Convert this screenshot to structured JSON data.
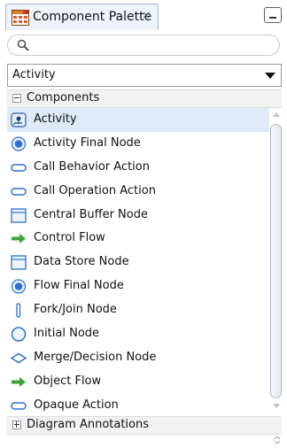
{
  "tab": {
    "title": "Component Palette",
    "close": "×"
  },
  "search": {
    "placeholder": "",
    "value": ""
  },
  "dropdown": {
    "selected": "Activity"
  },
  "sections": {
    "components": "Components",
    "diagram_annotations": "Diagram Annotations"
  },
  "items": [
    {
      "label": "Activity",
      "icon": "activity-icon"
    },
    {
      "label": "Activity Final Node",
      "icon": "activity-final-node-icon"
    },
    {
      "label": "Call Behavior Action",
      "icon": "action-icon"
    },
    {
      "label": "Call Operation Action",
      "icon": "action-icon"
    },
    {
      "label": "Central Buffer Node",
      "icon": "buffer-node-icon"
    },
    {
      "label": "Control Flow",
      "icon": "flow-arrow-icon"
    },
    {
      "label": "Data Store Node",
      "icon": "buffer-node-icon"
    },
    {
      "label": "Flow Final Node",
      "icon": "final-node-icon"
    },
    {
      "label": "Fork/Join Node",
      "icon": "fork-join-icon"
    },
    {
      "label": "Initial Node",
      "icon": "initial-node-icon"
    },
    {
      "label": "Merge/Decision Node",
      "icon": "decision-icon"
    },
    {
      "label": "Object Flow",
      "icon": "flow-arrow-icon"
    },
    {
      "label": "Opaque Action",
      "icon": "action-icon"
    }
  ],
  "colors": {
    "selection": "#dfe9f7",
    "accent": "#2a6fd6",
    "flow": "#3aa53a"
  }
}
